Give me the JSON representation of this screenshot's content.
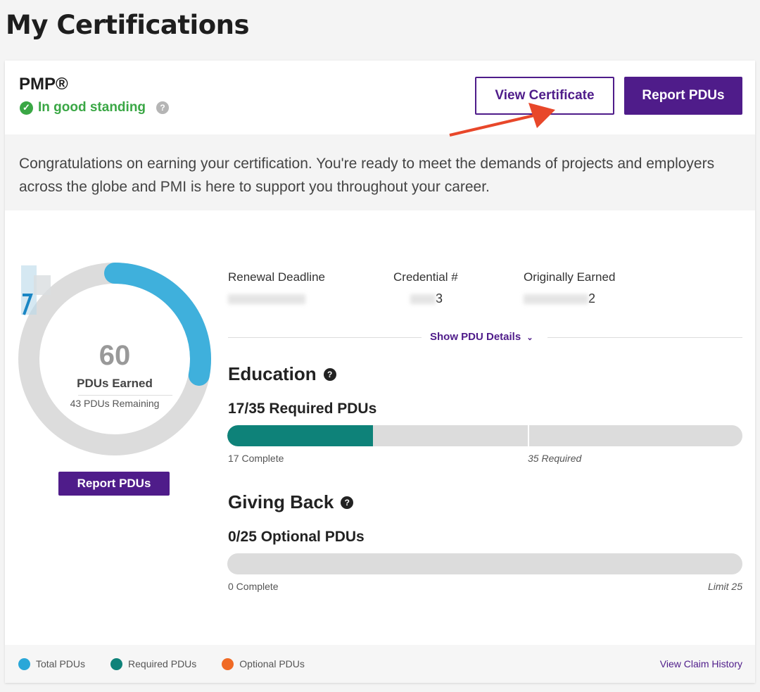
{
  "page": {
    "title": "My Certifications"
  },
  "certification": {
    "name": "PMP®",
    "status": "In good standing",
    "buttons": {
      "view_certificate": "View Certificate",
      "report_pdus": "Report PDUs"
    },
    "congrats_text": "Congratulations on earning your certification. You're ready to meet the demands of projects and employers across the globe and PMI is here to support you throughout your career."
  },
  "pdu_summary": {
    "total": "60",
    "earned_label": "PDUs Earned",
    "remaining_label": "43 PDUs Remaining",
    "report_button": "Report PDUs",
    "progress_fraction": 0.28
  },
  "meta": {
    "renewal_deadline": {
      "label": "Renewal Deadline",
      "value": ""
    },
    "credential": {
      "label": "Credential #",
      "value": "3"
    },
    "originally_earned": {
      "label": "Originally Earned",
      "value": "2"
    }
  },
  "show_pdu_details": "Show PDU Details",
  "education": {
    "title": "Education",
    "summary": "17/35 Required PDUs",
    "complete_label": "17 Complete",
    "required_label": "35 Required",
    "complete": 17,
    "required": 35,
    "max": 60
  },
  "giving_back": {
    "title": "Giving Back",
    "summary": "0/25 Optional PDUs",
    "complete_label": "0 Complete",
    "limit_label": "Limit 25",
    "complete": 0,
    "limit": 25
  },
  "legend": {
    "total": "Total PDUs",
    "required": "Required PDUs",
    "optional": "Optional PDUs",
    "claim_history": "View Claim History"
  },
  "colors": {
    "brand_purple": "#4f1c8a",
    "standing_green": "#3aa745",
    "total_blue": "#2aa7d8",
    "required_teal": "#0e8279",
    "optional_orange": "#f06a25"
  }
}
